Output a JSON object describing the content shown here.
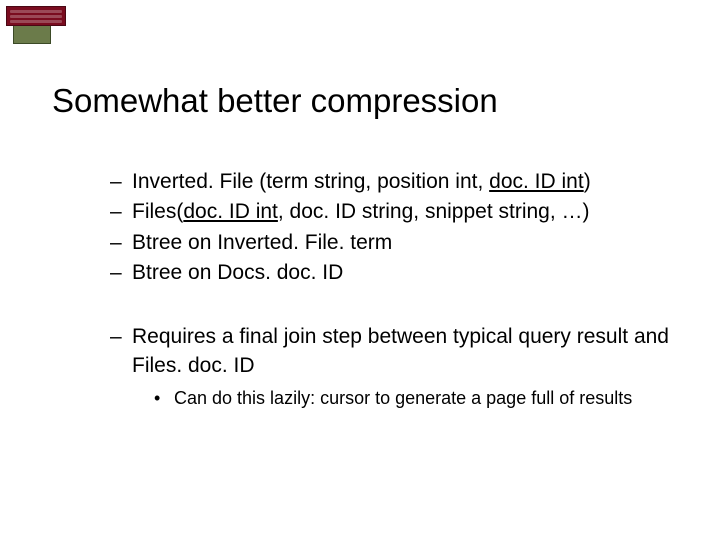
{
  "title": "Somewhat better compression",
  "bullets1": [
    {
      "pre": "Inverted. File (term string, position int, ",
      "u": "doc. ID int",
      "post": ")"
    },
    {
      "pre": "Files(",
      "u": "doc. ID int",
      "post": ", doc. ID string, snippet string, …)"
    },
    {
      "text": "Btree on Inverted. File. term"
    },
    {
      "text": "Btree on Docs. doc. ID"
    }
  ],
  "bullets2": [
    {
      "text": "Requires a final join step between typical query result and Files. doc. ID",
      "sub": [
        "Can do this lazily: cursor to generate a page full of results"
      ]
    }
  ]
}
